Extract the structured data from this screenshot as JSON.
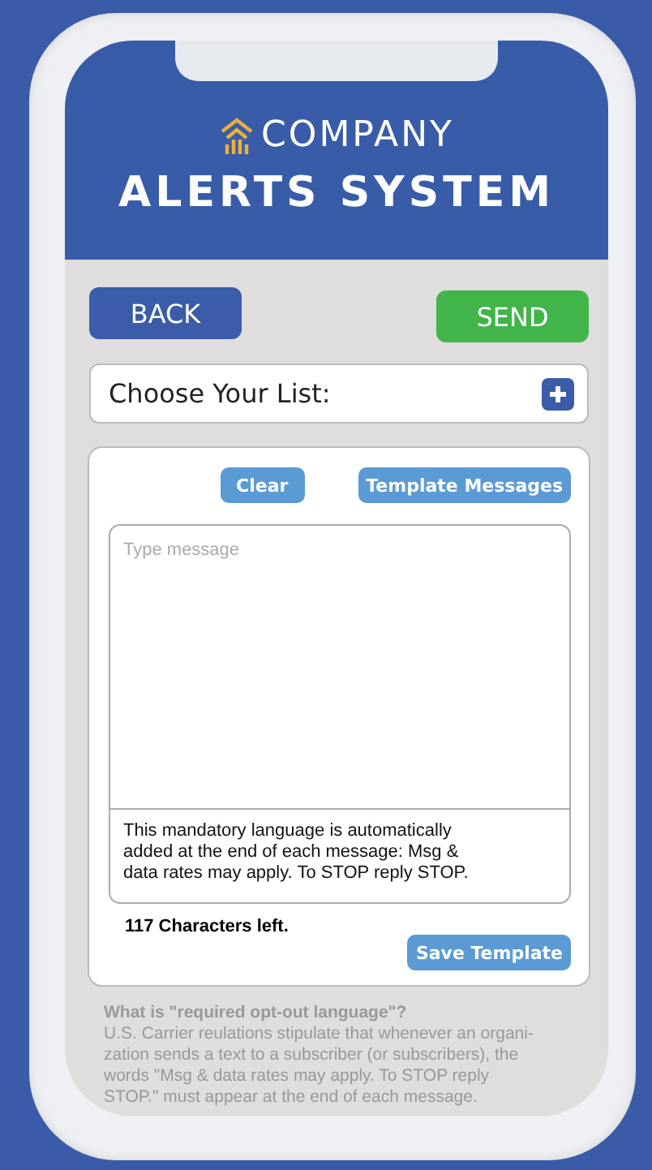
{
  "header": {
    "brand": "COMPANY",
    "title": "ALERTS SYSTEM"
  },
  "actions": [
    {
      "kind": "back",
      "label": "BACK"
    },
    {
      "kind": "send",
      "label": "SEND"
    }
  ],
  "list_picker": {
    "label": "Choose Your List:"
  },
  "composer": {
    "buttons": [
      {
        "label": "Clear"
      },
      {
        "label": "Template Messages"
      }
    ],
    "message": {
      "placeholder": "Type message"
    },
    "mandatory_note": "This mandatory language is automatically added at the end of each message: Msg & data rates may apply. To STOP reply STOP.",
    "characters_left": "117 Characters left.",
    "save_button": "Save Template"
  },
  "footnote": {
    "question": "What is \"required opt-out language\"?",
    "lines": [
      "U.S. Carrier reulations stipulate that whenever an organi-",
      "zation sends a text to a subscriber (or subscribers), the",
      "words \"Msg & data rates may apply. To STOP reply",
      "STOP.\" must appear at the end of each message."
    ]
  }
}
